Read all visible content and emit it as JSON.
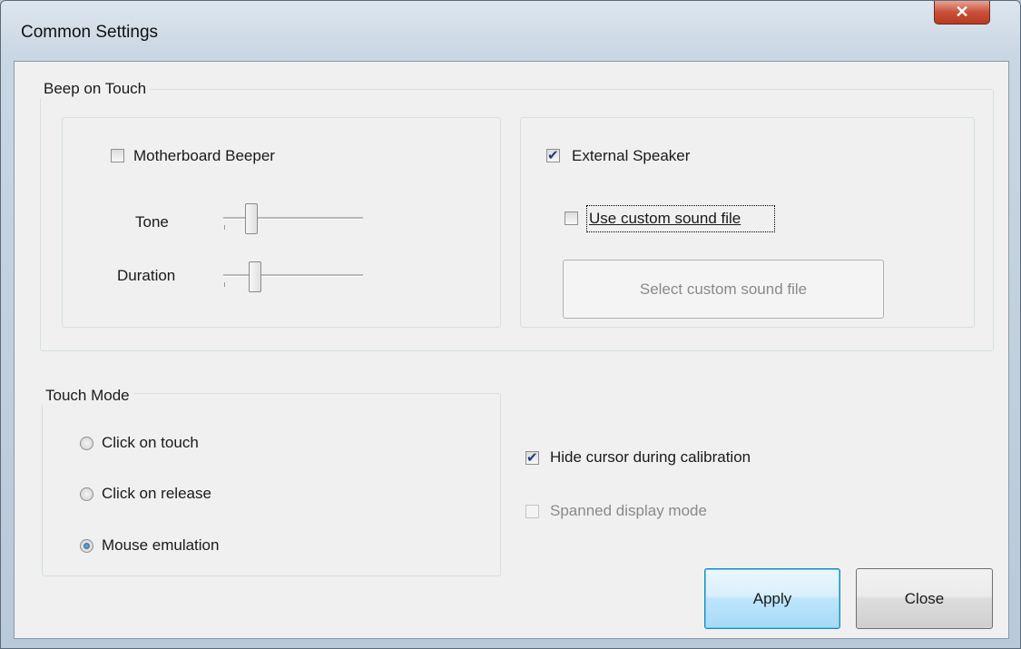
{
  "window": {
    "title": "Common Settings",
    "close_glyph": "✕"
  },
  "beep_group": {
    "label": "Beep on Touch",
    "motherboard": {
      "label": "Motherboard Beeper",
      "checked": false
    },
    "tone_label": "Tone",
    "duration_label": "Duration",
    "tone_value": 0.2,
    "duration_value": 0.2,
    "external": {
      "label": "External Speaker",
      "checked": true
    },
    "custom_sound": {
      "label": "Use custom sound file",
      "checked": false
    },
    "select_button": "Select custom sound file"
  },
  "touch_mode": {
    "label": "Touch Mode",
    "options": [
      {
        "label": "Click on touch",
        "selected": false
      },
      {
        "label": "Click on release",
        "selected": false
      },
      {
        "label": "Mouse emulation",
        "selected": true
      }
    ]
  },
  "hide_cursor": {
    "label": "Hide cursor during calibration",
    "checked": true
  },
  "spanned": {
    "label": "Spanned display mode",
    "checked": false,
    "enabled": false
  },
  "buttons": {
    "apply": "Apply",
    "close": "Close"
  }
}
